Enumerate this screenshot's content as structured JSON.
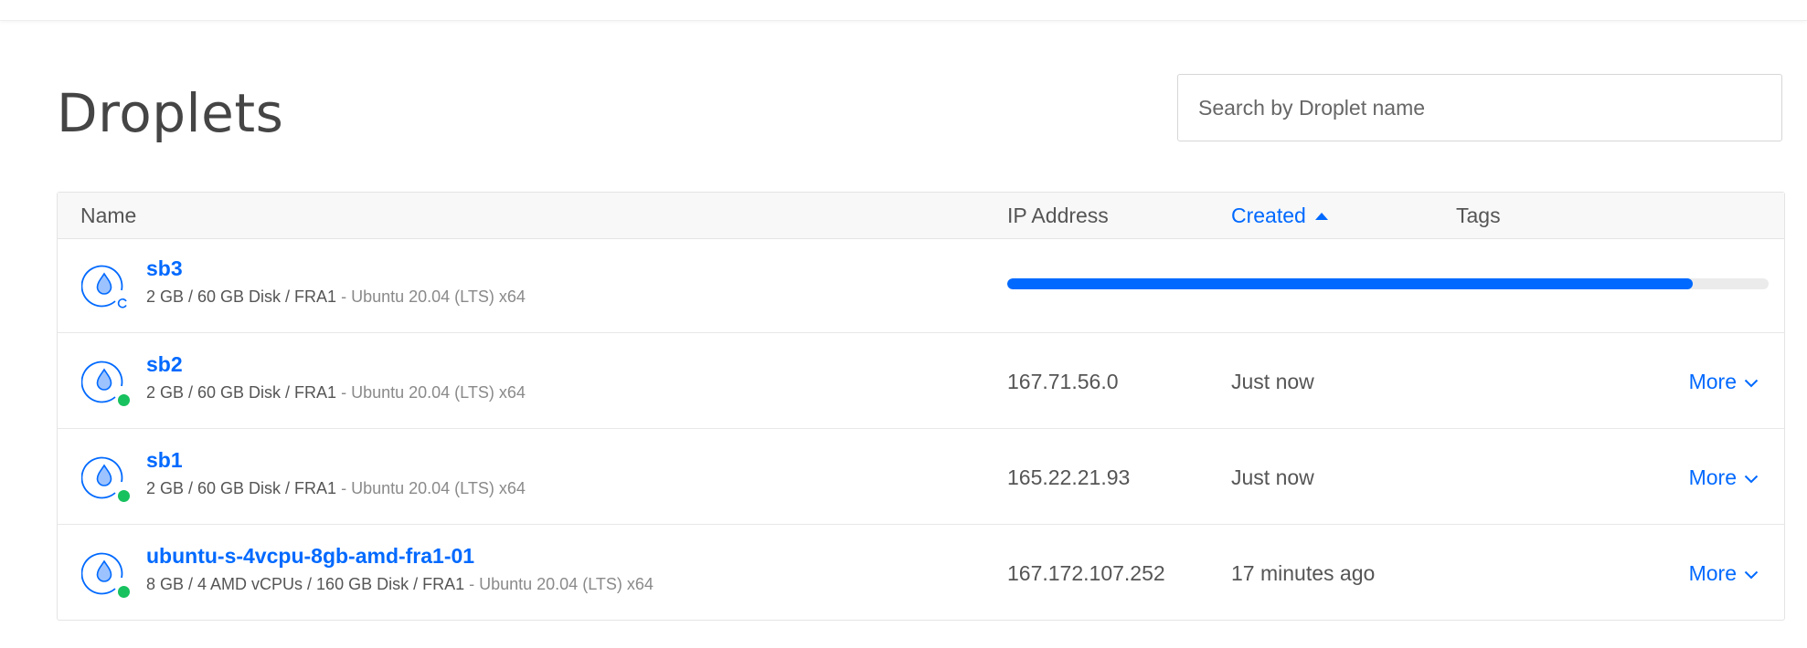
{
  "page": {
    "title": "Droplets"
  },
  "search": {
    "placeholder": "Search by Droplet name",
    "value": ""
  },
  "table": {
    "columns": {
      "name": "Name",
      "ip": "IP Address",
      "created": "Created",
      "tags": "Tags"
    },
    "sorted_by": "created",
    "sort_direction": "ascending",
    "rows": [
      {
        "name": "sb3",
        "specs": "2 GB / 60 GB Disk / FRA1",
        "image": " - Ubuntu 20.04 (LTS) x64",
        "status": "creating",
        "progress": 0.9,
        "ip": "",
        "created": "",
        "tags": "",
        "action": ""
      },
      {
        "name": "sb2",
        "specs": "2 GB / 60 GB Disk / FRA1",
        "image": " - Ubuntu 20.04 (LTS) x64",
        "status": "active",
        "ip": "167.71.56.0",
        "created": "Just now",
        "tags": "",
        "action": "More"
      },
      {
        "name": "sb1",
        "specs": "2 GB / 60 GB Disk / FRA1",
        "image": " - Ubuntu 20.04 (LTS) x64",
        "status": "active",
        "ip": "165.22.21.93",
        "created": "Just now",
        "tags": "",
        "action": "More"
      },
      {
        "name": "ubuntu-s-4vcpu-8gb-amd-fra1-01",
        "specs": "8 GB / 4 AMD vCPUs / 160 GB Disk / FRA1",
        "image": " - Ubuntu 20.04 (LTS) x64",
        "status": "active",
        "ip": "167.172.107.252",
        "created": "17 minutes ago",
        "tags": "",
        "action": "More"
      }
    ]
  },
  "icons": {
    "droplet": "droplet-icon",
    "status_active": "status-dot-green",
    "status_creating": "refresh-icon",
    "sort": "caret-up-icon",
    "more": "chevron-down-icon"
  },
  "colors": {
    "accent": "#0069ff",
    "status_active": "#17c15e",
    "progress_track": "#ebebeb"
  }
}
